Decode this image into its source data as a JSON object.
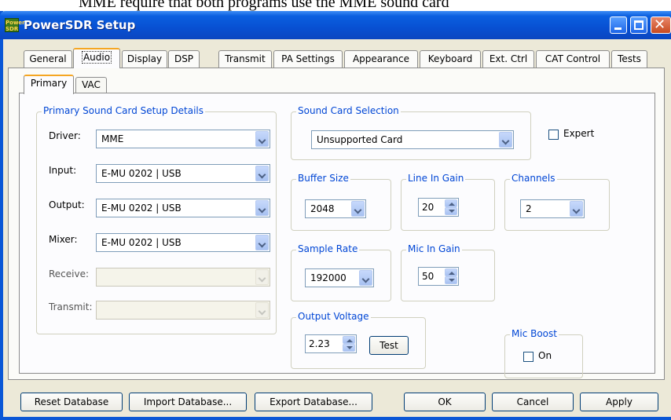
{
  "background_doc_text": "MME require that both programs use the MME sound card",
  "window": {
    "title": "PowerSDR Setup",
    "icon_text": "Power SDR"
  },
  "tabs": [
    "General",
    "Audio",
    "Display",
    "DSP",
    "Transmit",
    "PA Settings",
    "Appearance",
    "Keyboard",
    "Ext. Ctrl",
    "CAT Control",
    "Tests"
  ],
  "active_tab": "Audio",
  "subtabs": [
    "Primary",
    "VAC"
  ],
  "active_subtab": "Primary",
  "primary": {
    "title": "Primary Sound Card Setup Details",
    "driver": {
      "label": "Driver:",
      "value": "MME"
    },
    "input": {
      "label": "Input:",
      "value": "E-MU 0202 | USB"
    },
    "output": {
      "label": "Output:",
      "value": "E-MU 0202 | USB"
    },
    "mixer": {
      "label": "Mixer:",
      "value": "E-MU 0202 | USB"
    },
    "receive": {
      "label": "Receive:",
      "value": ""
    },
    "transmit": {
      "label": "Transmit:",
      "value": ""
    }
  },
  "soundcard": {
    "title": "Sound Card Selection",
    "value": "Unsupported Card"
  },
  "expert": {
    "label": "Expert",
    "checked": false
  },
  "buffer": {
    "title": "Buffer Size",
    "value": "2048"
  },
  "line_in": {
    "title": "Line In Gain",
    "value": "20"
  },
  "channels": {
    "title": "Channels",
    "value": "2"
  },
  "sample_rate": {
    "title": "Sample Rate",
    "value": "192000"
  },
  "mic_in": {
    "title": "Mic In Gain",
    "value": "50"
  },
  "output_voltage": {
    "title": "Output Voltage",
    "value": "2.23",
    "test_label": "Test"
  },
  "mic_boost": {
    "title": "Mic Boost",
    "label": "On",
    "checked": false
  },
  "buttons": {
    "reset": "Reset Database",
    "import": "Import Database...",
    "export": "Export Database...",
    "ok": "OK",
    "cancel": "Cancel",
    "apply": "Apply"
  },
  "colors": {
    "titlebar": "#0a5fe0",
    "group_title": "#0046d5",
    "dialog_bg": "#ece9d8"
  }
}
